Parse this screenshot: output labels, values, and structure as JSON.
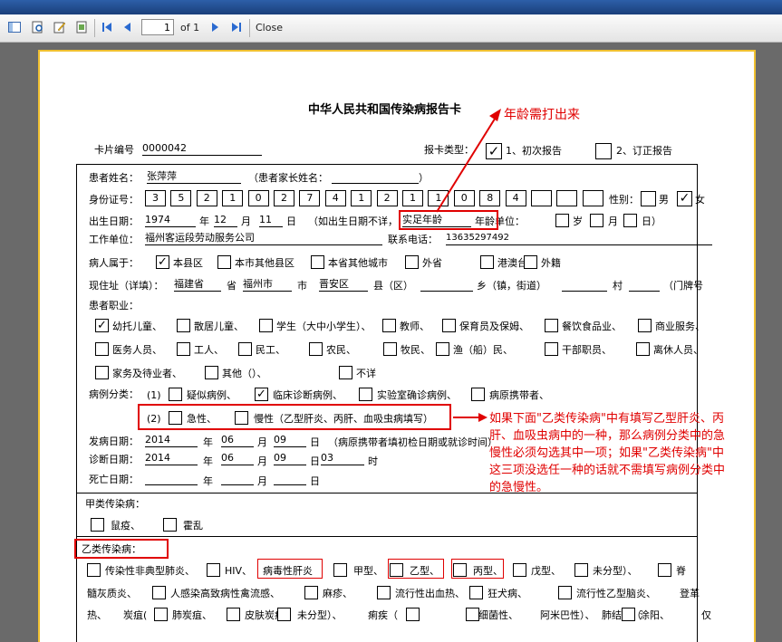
{
  "toolbar": {
    "page": "1",
    "of": "of 1",
    "close": "Close"
  },
  "form": {
    "title": "中华人民共和国传染病报告卡",
    "card_no_label": "卡片编号",
    "card_no": "0000042",
    "report_type_label": "报卡类型：",
    "initial": "1、初次报告",
    "revised": "2、订正报告",
    "patient_label": "患者姓名：",
    "patient": "张萍萍",
    "parent_label": "（患者家长姓名：",
    "paren_close": "）",
    "id_label": "身份证号：",
    "id_digits": [
      "3",
      "5",
      "2",
      "1",
      "0",
      "2",
      "7",
      "4",
      "1",
      "2",
      "1",
      "1",
      "0",
      "8",
      "4",
      "",
      "",
      ""
    ],
    "sex_label": "性别：",
    "male": "男",
    "female": "女",
    "dob_label": "出生日期：",
    "dob_year": "1974",
    "year": "年",
    "dob_month": "12",
    "month": "月",
    "dob_day": "11",
    "day": "日",
    "age_hint": "（如出生日期不详，",
    "age_value": "实足年龄",
    "age_unit_label": "年龄单位：",
    "sui": "岁",
    "yue": "月",
    "ri": "日）",
    "work_label": "工作单位：",
    "work": "福州客运段劳动服务公司",
    "phone_label": "联系电话：",
    "phone": "13635297492",
    "belong_label": "病人属于：",
    "belong": [
      "本县区",
      "本市其他县区",
      "本省其他城市",
      "外省",
      "港澳台",
      "外籍"
    ],
    "addr_label": "现住址（详填）：",
    "addr_prov": "福建省",
    "sheng": "省",
    "addr_city": "福州市",
    "shi": "市",
    "addr_county": "晋安区",
    "xian": "县（区）",
    "xiang": "乡（镇，街道）",
    "cun": "村",
    "menpai": "（门牌号",
    "occ_label": "患者职业：",
    "occ_row1": [
      "幼托儿童、",
      "散居儿童、",
      "学生（大中小学生）、",
      "教师、",
      "保育员及保姆、",
      "餐饮食品业、",
      "商业服务、"
    ],
    "occ_row2": [
      "医务人员、",
      "工人、",
      "民工、",
      "农民、",
      "牧民、",
      "渔（船）民、",
      "干部职员、",
      "离休人员、"
    ],
    "occ_row3": [
      "家务及待业者、",
      "其他（）、",
      "不详"
    ],
    "case_label": "病例分类：",
    "case_1": "(1)",
    "case_opts": [
      "疑似病例、",
      "临床诊断病例、",
      "实验室确诊病例、",
      "病原携带者、"
    ],
    "case_2": "(2)",
    "acute": "急性、",
    "chronic": "慢性（乙型肝炎、丙肝、血吸虫病填写）",
    "onset_label": "发病日期：",
    "onset_year": "2014",
    "onset_month": "06",
    "onset_day": "09",
    "onset_note": "（病原携带者填初检日期或就诊时间）",
    "diag_label": "诊断日期：",
    "diag_year": "2014",
    "diag_month": "06",
    "diag_day": "09",
    "diag_hour": "03",
    "shi_hour": "时",
    "death_label": "死亡日期：",
    "classA_label": "甲类传染病：",
    "classA": [
      "鼠疫、",
      "霍乱"
    ],
    "classB_label": "乙类传染病：",
    "b_row1": [
      "传染性非典型肺炎、",
      "HIV、",
      "病毒性肝炎",
      "甲型、",
      "乙型、",
      "丙型、",
      "戊型、",
      "未分型）、",
      "脊"
    ],
    "b_row2": [
      "髓灰质炎、",
      "人感染高致病性禽流感、",
      "麻疹、",
      "流行性出血热、",
      "狂犬病、",
      "流行性乙型脑炎、",
      "登革"
    ],
    "b_row3": [
      "热、",
      "炭疽(",
      "肺炭疽、",
      "皮肤炭疽、",
      "未分型）、",
      "痢疾（",
      "细菌性、",
      "阿米巴性）、",
      "肺结核（",
      "涂阳、",
      "仅"
    ]
  },
  "annotations": {
    "age_note": "年龄需打出来",
    "case_note": [
      "如果下面\"乙类传染病\"中有填写乙型肝炎、丙",
      "肝、血吸虫病中的一种，那么病例分类中的急",
      "慢性必须勾选其中一项；如果\"乙类传染病\"中",
      "这三项没选任一种的话就不需填写病例分类中",
      "的急慢性。"
    ]
  }
}
